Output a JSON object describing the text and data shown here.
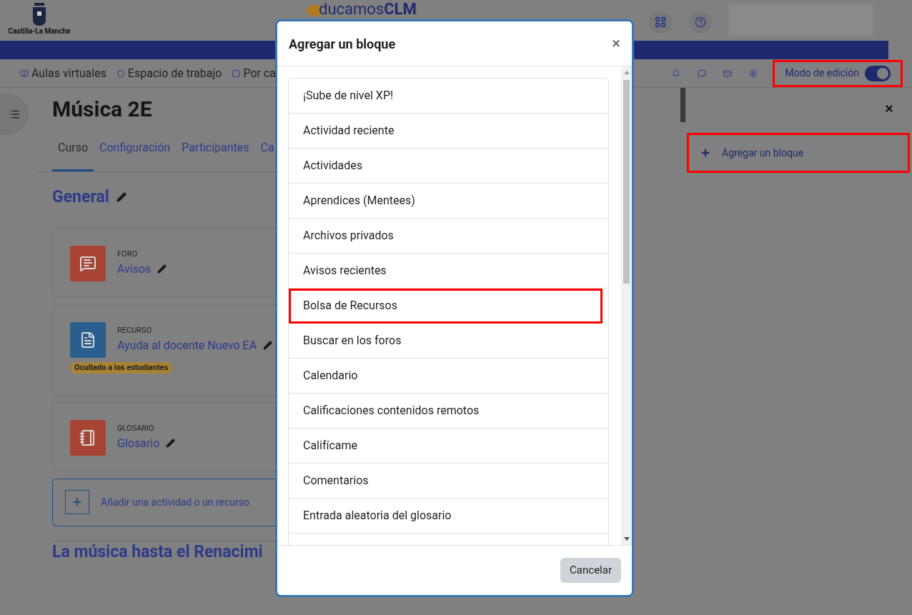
{
  "header": {
    "region_logo": "Castilla-La Mancha",
    "brand": {
      "text": "ducamos",
      "bold": "CLM"
    }
  },
  "nav": [
    {
      "label": "Aulas virtuales",
      "kind": "book"
    },
    {
      "label": "Espacio de trabajo",
      "kind": "shield"
    },
    {
      "label": "Por ca",
      "kind": "box"
    }
  ],
  "edit_mode": {
    "label": "Modo de edición",
    "on": true,
    "highlighted": true
  },
  "course": {
    "title": "Música 2E",
    "tabs": [
      {
        "label": "Curso",
        "selected": true
      },
      {
        "label": "Configuración",
        "selected": false
      },
      {
        "label": "Participantes",
        "selected": false
      },
      {
        "label": "Ca",
        "selected": false
      }
    ],
    "section": "General",
    "activities": [
      {
        "type": "FORO",
        "name": "Avisos",
        "kind": "forum"
      },
      {
        "type": "RECURSO",
        "name": "Ayuda al docente Nuevo EA",
        "kind": "resource",
        "badge": "Ocultado a los estudiantes"
      },
      {
        "type": "GLOSARIO",
        "name": "Glosario",
        "kind": "glossary"
      }
    ],
    "add_activity": "Añadir una actividad o un recurso",
    "next_section": "La música hasta el Renacimi"
  },
  "drawer": {
    "add_block": "Agregar un bloque",
    "highlighted": true
  },
  "modal": {
    "title": "Agregar un bloque",
    "close": "×",
    "items": [
      {
        "label": "¡Sube de nivel XP!",
        "highlighted": false
      },
      {
        "label": "Actividad reciente",
        "highlighted": false
      },
      {
        "label": "Actividades",
        "highlighted": false
      },
      {
        "label": "Aprendices (Mentees)",
        "highlighted": false
      },
      {
        "label": "Archivos privados",
        "highlighted": false
      },
      {
        "label": "Avisos recientes",
        "highlighted": false
      },
      {
        "label": "Bolsa de Recursos",
        "highlighted": true
      },
      {
        "label": "Buscar en los foros",
        "highlighted": false
      },
      {
        "label": "Calendario",
        "highlighted": false
      },
      {
        "label": "Calificaciones contenidos remotos",
        "highlighted": false
      },
      {
        "label": "Califícame",
        "highlighted": false
      },
      {
        "label": "Comentarios",
        "highlighted": false
      },
      {
        "label": "Entrada aleatoria del glosario",
        "highlighted": false
      }
    ],
    "cancel": "Cancelar"
  }
}
